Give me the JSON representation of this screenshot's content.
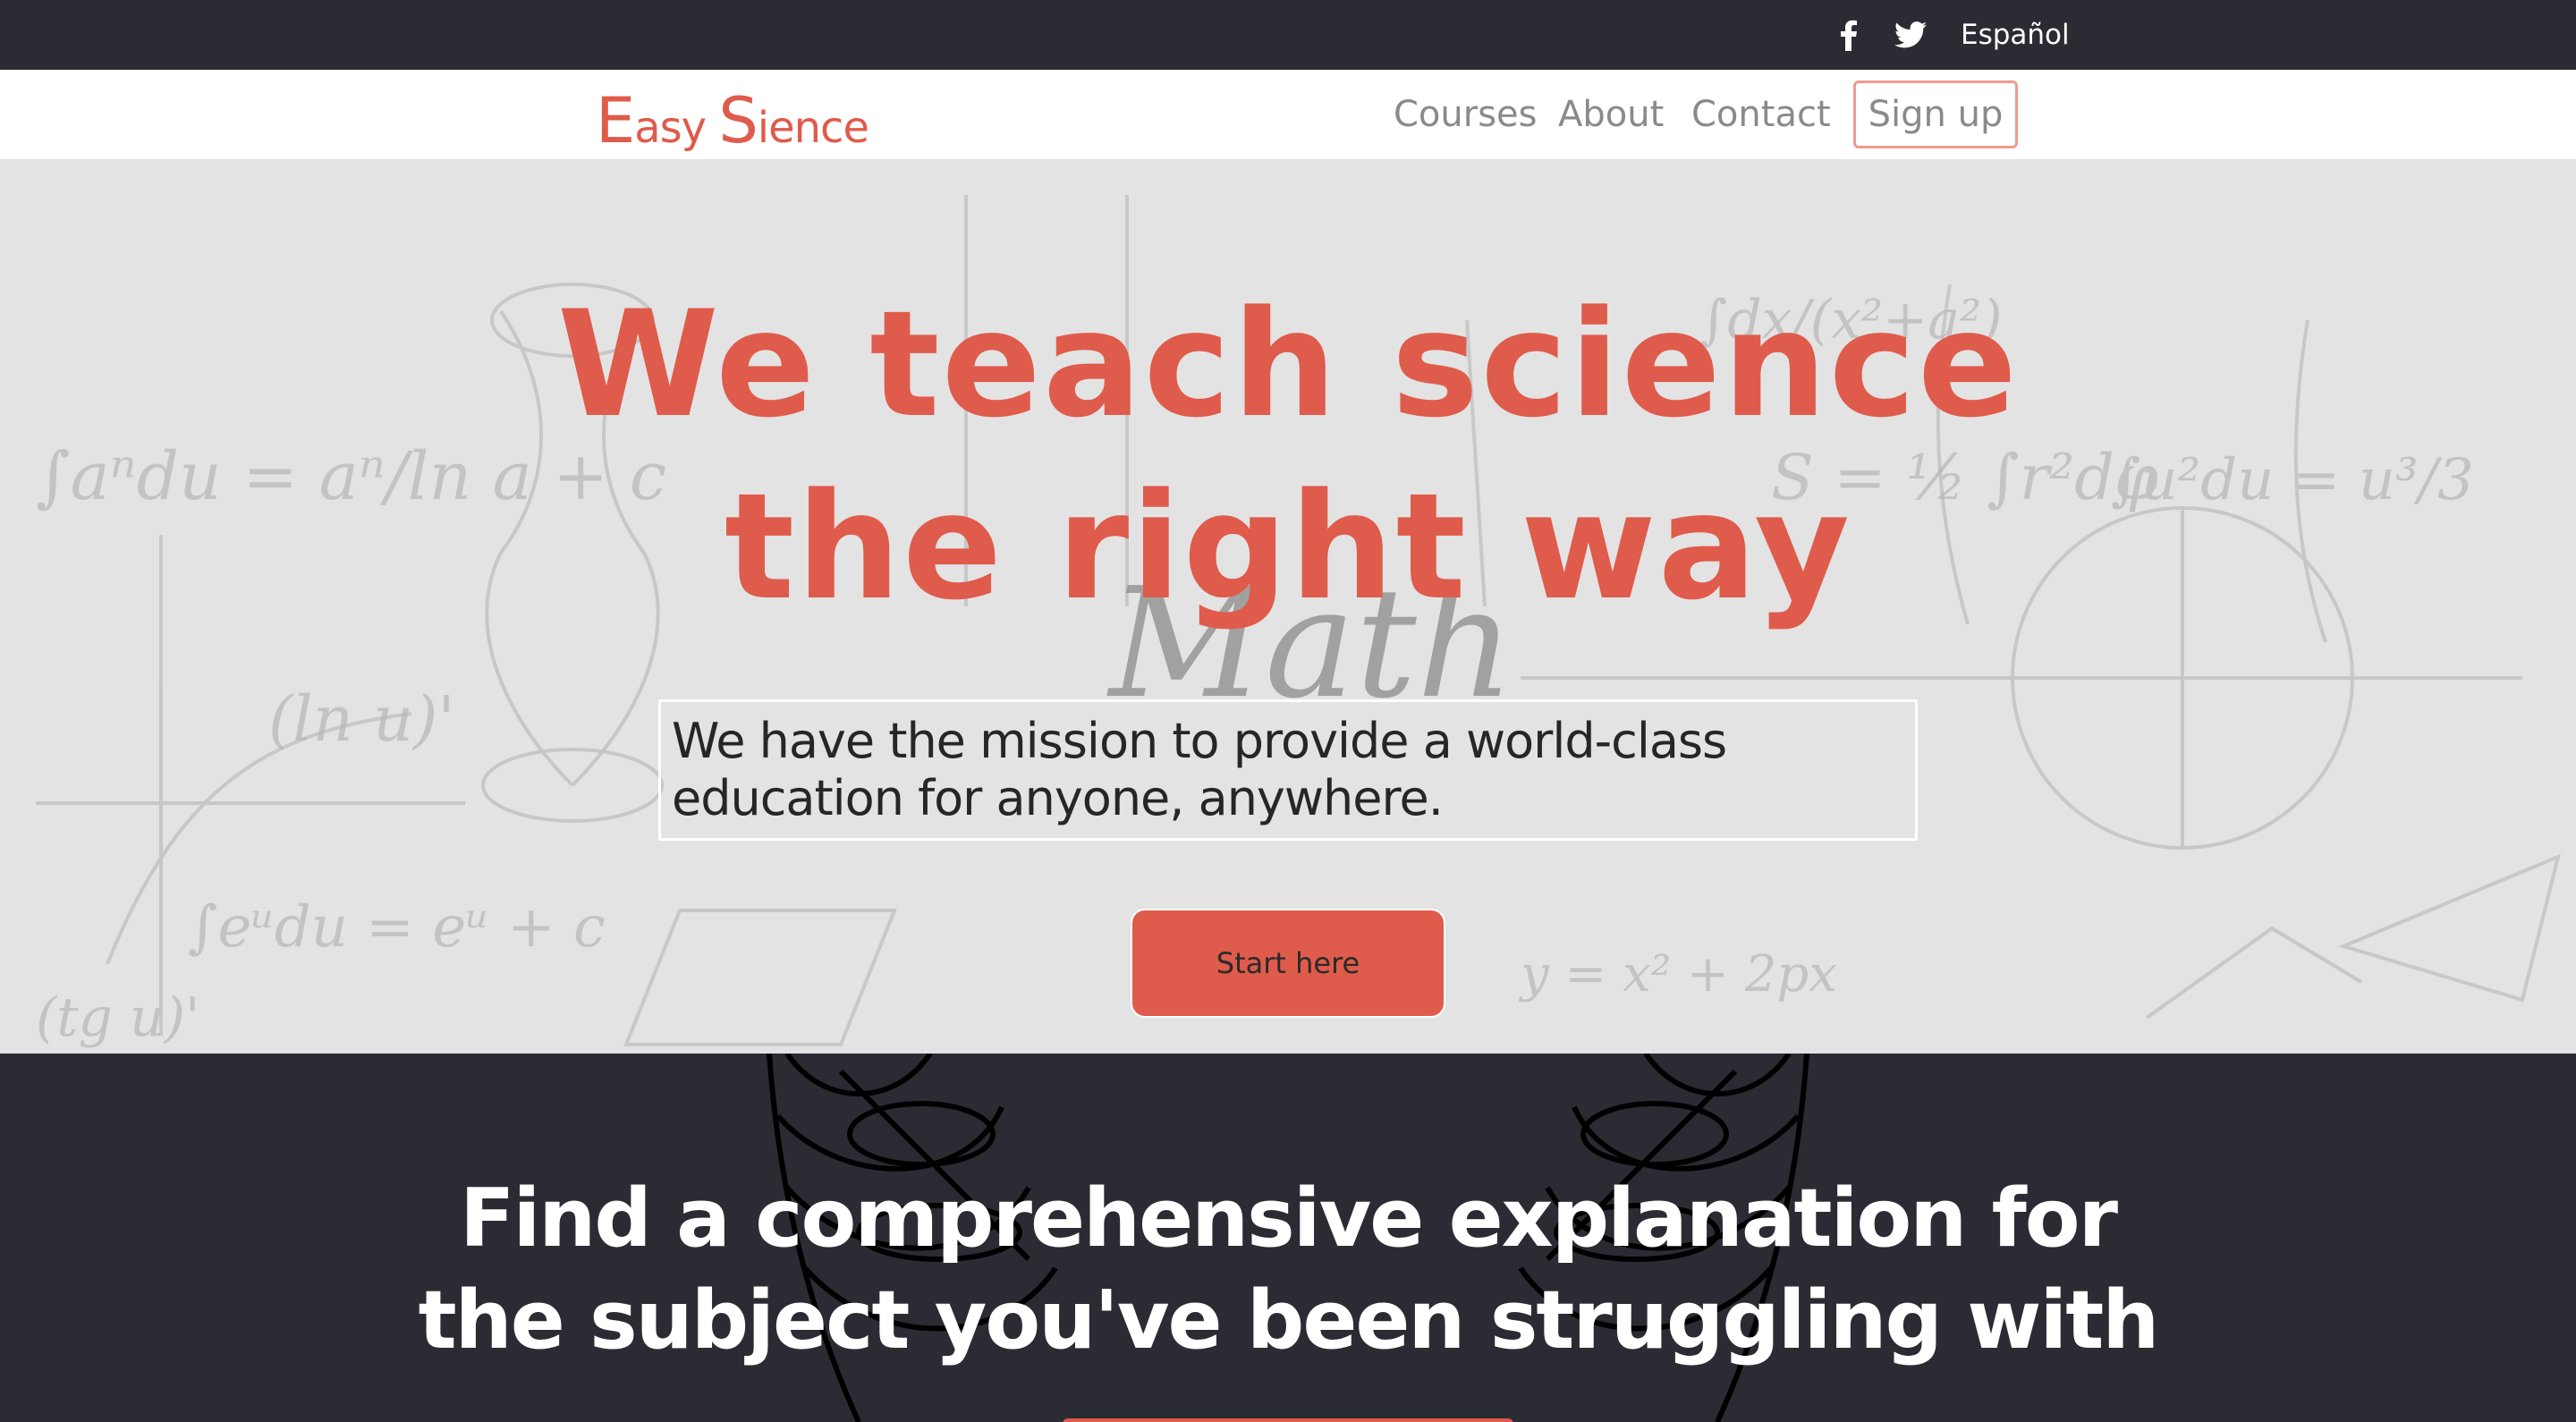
{
  "topbar": {
    "facebook_icon": "facebook-icon",
    "twitter_icon": "twitter-icon",
    "language": "Español"
  },
  "navbar": {
    "brand_first_cap": "E",
    "brand_first_rest": "asy ",
    "brand_second_cap": "S",
    "brand_second_rest": "ience",
    "links": [
      "Courses",
      "About",
      "Contact"
    ],
    "signup": "Sign up"
  },
  "hero": {
    "title_line1": "We teach science",
    "title_line2": "the right way",
    "subtitle": "We have the mission to provide a world-class education for anyone, anywhere.",
    "cta": "Start here",
    "background_word": "Math"
  },
  "section": {
    "title_line1": "Find a comprehensive explanation for",
    "title_line2": "the subject you've been struggling with"
  },
  "colors": {
    "accent": "#df5b4b",
    "dark": "#2b2c33",
    "nav_text": "#8a8a8a"
  }
}
